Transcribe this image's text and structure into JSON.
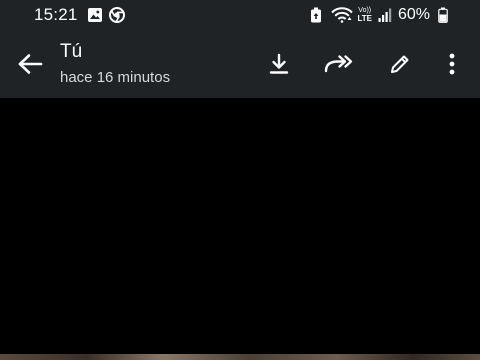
{
  "status_bar": {
    "time": "15:21",
    "volte_label_top": "Vo))",
    "volte_label_bottom": "LTE",
    "battery_percent": "60%",
    "icons": [
      "gallery-icon",
      "chrome-icon",
      "battery-saver-icon",
      "wifi-icon",
      "volte-lte-icon",
      "signal-icon",
      "battery-icon"
    ]
  },
  "header": {
    "contact_name": "Tú",
    "subtitle": "hace 16 minutos",
    "actions": [
      "back-arrow-icon",
      "download-icon",
      "forward-icon",
      "pencil-icon",
      "more-vert-icon"
    ]
  },
  "colors": {
    "bar_background": "#1f2326",
    "media_background": "#000000",
    "text_primary": "#ffffff",
    "text_secondary": "#d6d9db"
  }
}
